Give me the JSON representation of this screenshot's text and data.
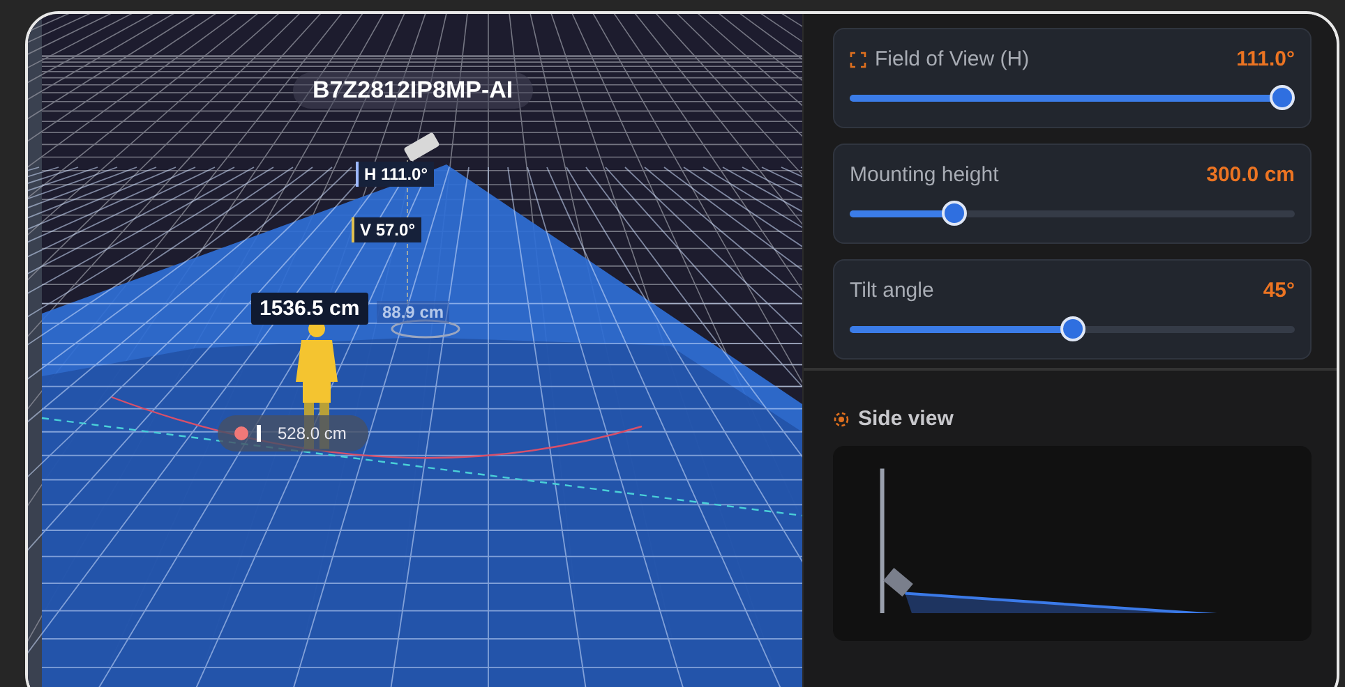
{
  "scene": {
    "camera_label": "B7Z2812IP8MP-AI",
    "h_angle": "H 111.0°",
    "v_angle": "V 57.0°",
    "distance": "1536.5 cm",
    "radius": "88.9 cm",
    "width_reading": "528.0 cm"
  },
  "controls": [
    {
      "kind": "fov",
      "label": "Field of View (H)",
      "value": "111.0°",
      "level": 1.0
    },
    {
      "kind": "plain",
      "label": "Mounting height",
      "value": "300.0 cm",
      "level": 0.22
    },
    {
      "kind": "plain",
      "label": "Tilt angle",
      "value": "45°",
      "level": 0.5
    }
  ],
  "side_view": {
    "title": "Side view"
  }
}
